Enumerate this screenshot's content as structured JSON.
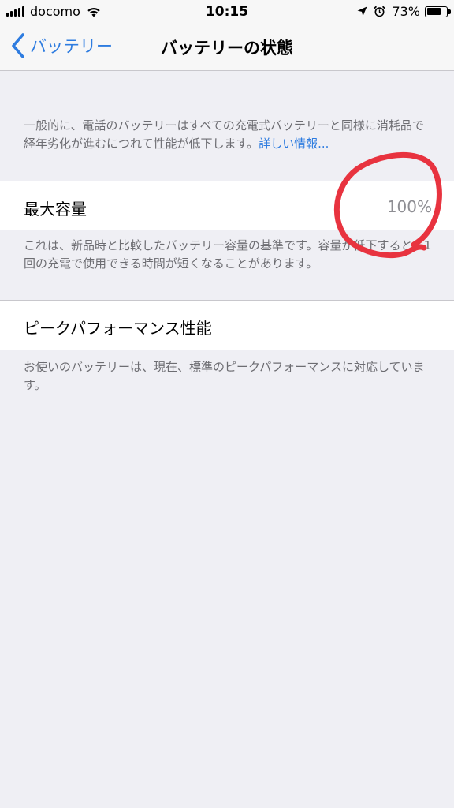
{
  "status_bar": {
    "carrier": "docomo",
    "time": "10:15",
    "battery_percent": "73%",
    "battery_level": 0.73,
    "signal_icon": "signal-bars-icon",
    "wifi_icon": "wifi-icon",
    "location_icon": "location-arrow-icon",
    "alarm_icon": "alarm-clock-icon"
  },
  "nav": {
    "back_label": "バッテリー",
    "title": "バッテリーの状態"
  },
  "intro": {
    "text": "一般的に、電話のバッテリーはすべての充電式バッテリーと同様に消耗品で経年劣化が進むにつれて性能が低下します。",
    "link": "詳しい情報..."
  },
  "max_capacity": {
    "label": "最大容量",
    "value": "100%",
    "footnote": "これは、新品時と比較したバッテリー容量の基準です。容量が低下すると、1回の充電で使用できる時間が短くなることがあります。"
  },
  "peak_performance": {
    "label": "ピークパフォーマンス性能",
    "footnote": "お使いのバッテリーは、現在、標準のピークパフォーマンスに対応しています。"
  },
  "colors": {
    "accent": "#2e7ce0",
    "background": "#efeff4",
    "annotation_red": "#e8333f"
  }
}
